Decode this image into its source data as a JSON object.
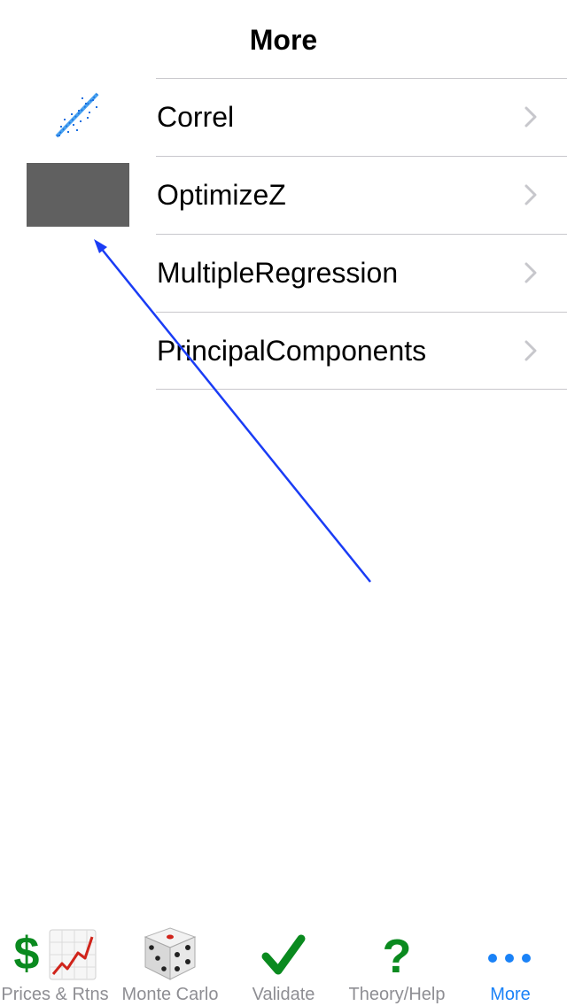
{
  "nav": {
    "title": "More"
  },
  "list": {
    "items": [
      {
        "label": "Correl",
        "icon": "correlation-scatter-icon"
      },
      {
        "label": "OptimizeZ",
        "icon": "placeholder-thumbnail"
      },
      {
        "label": "MultipleRegression",
        "icon": ""
      },
      {
        "label": "PrincipalComponents",
        "icon": ""
      }
    ]
  },
  "tabs": [
    {
      "label": "Prices & Rtns",
      "icon": "dollar-chart-icon",
      "active": false
    },
    {
      "label": "Monte Carlo",
      "icon": "dice-icon",
      "active": false
    },
    {
      "label": "Validate",
      "icon": "checkmark-icon",
      "active": false
    },
    {
      "label": "Theory/Help",
      "icon": "question-mark-icon",
      "active": false
    },
    {
      "label": "More",
      "icon": "more-dots-icon",
      "active": true
    }
  ],
  "colors": {
    "active_tab": "#1a82f7",
    "inactive_tab": "#8e8e93",
    "green_icon": "#0a8a1f",
    "separator": "#c8c7cc",
    "annotation_arrow": "#1a3cf5"
  }
}
